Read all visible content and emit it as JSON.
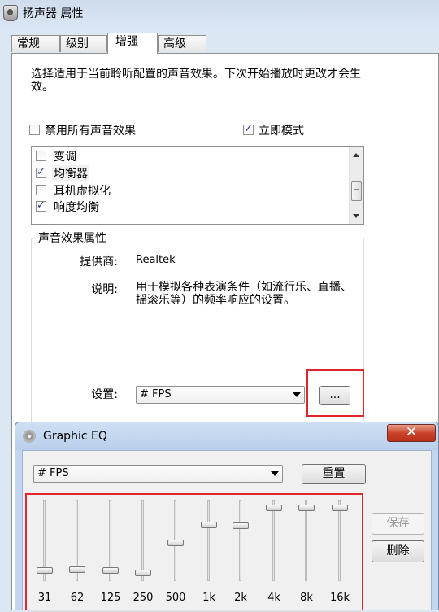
{
  "window": {
    "title": "扬声器 属性"
  },
  "tabs": [
    {
      "label": "常规"
    },
    {
      "label": "级别"
    },
    {
      "label": "增强"
    },
    {
      "label": "高级"
    }
  ],
  "enhancements": {
    "description": "选择适用于当前聆听配置的声音效果。下次开始播放时更改才会生效。",
    "disable_all": {
      "label": "禁用所有声音效果",
      "checked": false
    },
    "immediate_mode": {
      "label": "立即模式",
      "checked": true
    },
    "effects": [
      {
        "label": "变调",
        "checked": false
      },
      {
        "label": "均衡器",
        "checked": true
      },
      {
        "label": "耳机虚拟化",
        "checked": false
      },
      {
        "label": "响度均衡",
        "checked": true
      }
    ],
    "properties": {
      "group_title": "声音效果属性",
      "provider_label": "提供商:",
      "provider_value": "Realtek",
      "description_label": "说明:",
      "description_value": "用于模拟各种表演条件（如流行乐、直播、摇滚乐等）的频率响应的设置。",
      "settings_label": "设置:",
      "settings_value": "# FPS",
      "more_button": "..."
    }
  },
  "eq": {
    "title": "Graphic EQ",
    "close_label": "✕",
    "preset_value": "# FPS",
    "reset_button": "重置",
    "save_button": "保存",
    "delete_button": "删除",
    "bands": [
      {
        "freq": "31",
        "level": 0.1
      },
      {
        "freq": "62",
        "level": 0.11
      },
      {
        "freq": "125",
        "level": 0.1
      },
      {
        "freq": "250",
        "level": 0.07
      },
      {
        "freq": "500",
        "level": 0.47
      },
      {
        "freq": "1k",
        "level": 0.71
      },
      {
        "freq": "2k",
        "level": 0.7
      },
      {
        "freq": "4k",
        "level": 0.94
      },
      {
        "freq": "8k",
        "level": 0.94
      },
      {
        "freq": "16k",
        "level": 0.94
      }
    ]
  }
}
